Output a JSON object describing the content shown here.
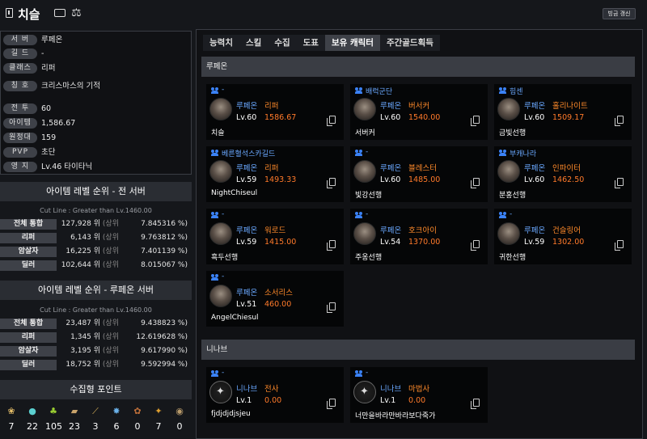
{
  "header": {
    "name": "치슬",
    "refresh_label": "빙금 갱신"
  },
  "info": [
    {
      "label": "서 버",
      "value": "루페온"
    },
    {
      "label": "길 드",
      "value": "-"
    },
    {
      "label": "클래스",
      "value": "리퍼"
    },
    {
      "label": "칭 호",
      "value": "크리스마스의 기적"
    },
    {
      "label": "전 투",
      "value": "60"
    },
    {
      "label": "아이템",
      "value": "1,586.67"
    },
    {
      "label": "원정대",
      "value": "159"
    },
    {
      "label": "PVP",
      "value": "초단"
    },
    {
      "label": "영 지",
      "value": "Lv.46 타이타닉"
    }
  ],
  "rank_all": {
    "title": "아이템 레벨 순위 - 전 서버",
    "cutline": "Cut Line : Greater than Lv.1460.00",
    "rows": [
      {
        "cls": "전체 통합",
        "rank": "127,928 위",
        "upper": "(상위",
        "pct": "7.845316 %)"
      },
      {
        "cls": "리퍼",
        "rank": "6,143 위",
        "upper": "(상위",
        "pct": "9.763812 %)"
      },
      {
        "cls": "암살자",
        "rank": "16,225 위",
        "upper": "(상위",
        "pct": "7.401139 %)"
      },
      {
        "cls": "딜러",
        "rank": "102,644 위",
        "upper": "(상위",
        "pct": "8.015067 %)"
      }
    ]
  },
  "rank_server": {
    "title": "아이템 레벨 순위 - 루페온 서버",
    "cutline": "Cut Line : Greater than Lv.1460.00",
    "rows": [
      {
        "cls": "전체 통합",
        "rank": "23,487 위",
        "upper": "(상위",
        "pct": "9.438823 %)"
      },
      {
        "cls": "리퍼",
        "rank": "1,345 위",
        "upper": "(상위",
        "pct": "12.619628 %)"
      },
      {
        "cls": "암살자",
        "rank": "3,195 위",
        "upper": "(상위",
        "pct": "9.617990 %)"
      },
      {
        "cls": "딜러",
        "rank": "18,752 위",
        "upper": "(상위",
        "pct": "9.592994 %)"
      }
    ]
  },
  "collect": {
    "title": "수집형 포인트",
    "items": [
      {
        "icon": "island-heart-icon",
        "glyph": "❀",
        "color": "#e8c06a",
        "count": "7"
      },
      {
        "icon": "orb-icon",
        "glyph": "●",
        "color": "#5bd0d0",
        "count": "22"
      },
      {
        "icon": "mokoko-seed-icon",
        "glyph": "♣",
        "color": "#9acd32",
        "count": "105"
      },
      {
        "icon": "map-icon",
        "glyph": "▰",
        "color": "#c9a36a",
        "count": "23"
      },
      {
        "icon": "brush-icon",
        "glyph": "⟋",
        "color": "#d9b25a",
        "count": "3"
      },
      {
        "icon": "crystal-icon",
        "glyph": "✸",
        "color": "#6ab0e8",
        "count": "6"
      },
      {
        "icon": "medal-icon",
        "glyph": "✿",
        "color": "#c0703a",
        "count": "0"
      },
      {
        "icon": "star-icon",
        "glyph": "✦",
        "color": "#e0a030",
        "count": "7"
      },
      {
        "icon": "coin-icon",
        "glyph": "◉",
        "color": "#b89a6a",
        "count": "0"
      }
    ]
  },
  "tabs": [
    "능력치",
    "스킬",
    "수집",
    "도표",
    "보유 캐릭터",
    "주간골드획득"
  ],
  "active_tab": 4,
  "servers": [
    {
      "name": "루페온",
      "chars": [
        {
          "guild": "-",
          "server": "루페온",
          "cls": "리퍼",
          "lv": "Lv.60",
          "il": "1586.67",
          "nick": "치슬"
        },
        {
          "guild": "배럭군단",
          "server": "루페온",
          "cls": "버서커",
          "lv": "Lv.60",
          "il": "1540.00",
          "nick": "서버커"
        },
        {
          "guild": "힘센",
          "server": "루페온",
          "cls": "홀리나이트",
          "lv": "Lv.60",
          "il": "1509.17",
          "nick": "금빛선행"
        },
        {
          "guild": "베른혈석스카길드",
          "server": "루페온",
          "cls": "리퍼",
          "lv": "Lv.59",
          "il": "1493.33",
          "nick": "NightChiseul"
        },
        {
          "guild": "-",
          "server": "루페온",
          "cls": "블레스터",
          "lv": "Lv.60",
          "il": "1485.00",
          "nick": "빛강선행"
        },
        {
          "guild": "부캐나라",
          "server": "루페온",
          "cls": "인파이터",
          "lv": "Lv.60",
          "il": "1462.50",
          "nick": "분홍선행"
        },
        {
          "guild": "-",
          "server": "루페온",
          "cls": "워로드",
          "lv": "Lv.59",
          "il": "1415.00",
          "nick": "흑두선행"
        },
        {
          "guild": "-",
          "server": "루페온",
          "cls": "호크아이",
          "lv": "Lv.54",
          "il": "1370.00",
          "nick": "주옹선행"
        },
        {
          "guild": "-",
          "server": "루페온",
          "cls": "건슬링어",
          "lv": "Lv.59",
          "il": "1302.00",
          "nick": "귀한선행"
        },
        {
          "guild": "-",
          "server": "루페온",
          "cls": "소서리스",
          "lv": "Lv.51",
          "il": "460.00",
          "nick": "AngelChiesul"
        }
      ]
    },
    {
      "name": "니나브",
      "chars": [
        {
          "guild": "-",
          "server": "니나브",
          "cls": "전사",
          "lv": "Lv.1",
          "il": "0.00",
          "nick": "fjdjdjdjsjeu"
        },
        {
          "guild": "-",
          "server": "니나브",
          "cls": "마법사",
          "lv": "Lv.1",
          "il": "0.00",
          "nick": "너만을바라만바라보다죽가"
        }
      ]
    }
  ]
}
